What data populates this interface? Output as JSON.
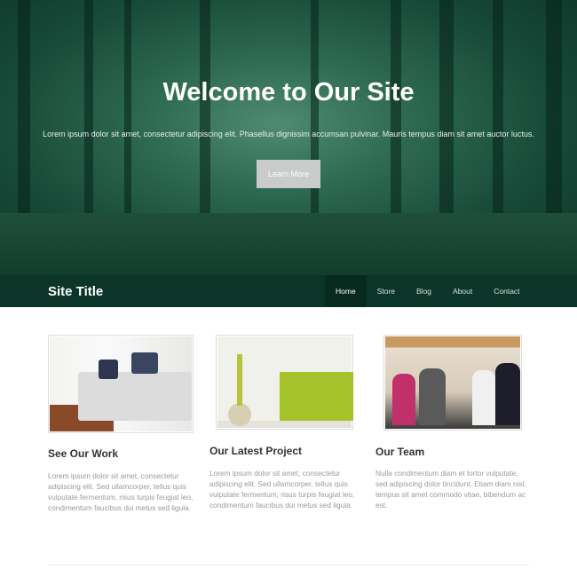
{
  "hero": {
    "title": "Welcome to Our Site",
    "text": "Lorem ipsum dolor sit amet, consectetur adipiscing elit. Phasellus dignissim accumsan pulvinar. Mauris tempus diam sit amet auctor luctus.",
    "button": "Learn More"
  },
  "nav": {
    "site_title": "Site Title",
    "items": [
      "Home",
      "Store",
      "Blog",
      "About",
      "Contact"
    ],
    "active": "Home"
  },
  "cards": [
    {
      "title": "See Our Work",
      "text": "Lorem ipsum dolor sit amet, consectetur adipiscing elit. Sed ullamcorper, tellus quis vulputate fermentum, risus turpis feugiat leo, condimentum faucibus dui metus sed ligula."
    },
    {
      "title": "Our Latest Project",
      "text": "Lorem ipsum dolor sit amet, consectetur adipiscing elit. Sed ullamcorper, tellus quis vulputate fermentum, risus turpis feugiat leo, condimentum faucibus dui metus sed ligula."
    },
    {
      "title": "Our Team",
      "text": "Nulla condimentum diam et tortor vulputate, sed adipiscing dolor tincidunt. Etiam diam nisl, tempus sit amet commodo vitae, bibendum ac est."
    }
  ]
}
